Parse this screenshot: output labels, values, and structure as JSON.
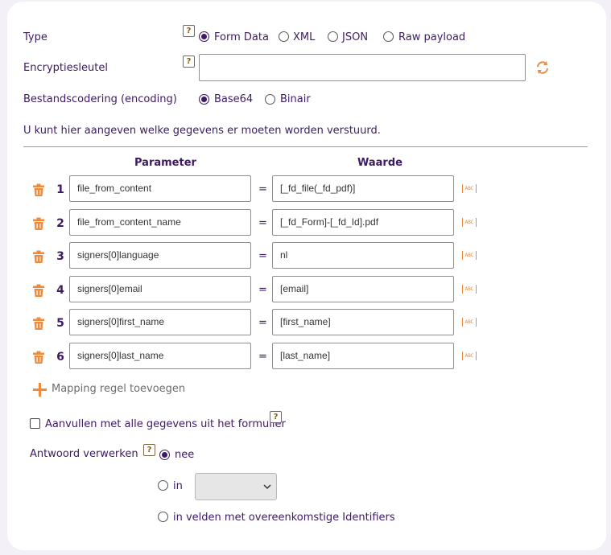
{
  "type_row": {
    "label": "Type",
    "options": [
      "Form Data",
      "XML",
      "JSON",
      "Raw payload"
    ],
    "selected": "Form Data"
  },
  "encryption": {
    "label": "Encryptiesleutel",
    "value": ""
  },
  "encoding": {
    "label": "Bestandscodering (encoding)",
    "options": [
      "Base64",
      "Binair"
    ],
    "selected": "Base64"
  },
  "help_glyph": "?",
  "info_text": "U kunt hier aangeven welke gegevens er moeten worden verstuurd.",
  "columns": {
    "parameter": "Parameter",
    "value": "Waarde"
  },
  "equals": "=",
  "abc_glyph": "ABC",
  "mapping": [
    {
      "num": "1",
      "param": "file_from_content",
      "value": "[_fd_file(_fd_pdf)]"
    },
    {
      "num": "2",
      "param": "file_from_content_name",
      "value": "[_fd_Form]-[_fd_Id].pdf"
    },
    {
      "num": "3",
      "param": "signers[0]language",
      "value": "nl"
    },
    {
      "num": "4",
      "param": "signers[0]email",
      "value": "[email]"
    },
    {
      "num": "5",
      "param": "signers[0]first_name",
      "value": "[first_name]"
    },
    {
      "num": "6",
      "param": "signers[0]last_name",
      "value": "[last_name]"
    }
  ],
  "add_rule_label": "Mapping regel toevoegen",
  "fill_all": {
    "label": "Aanvullen met alle gegevens uit het formulier",
    "checked": false
  },
  "response": {
    "label": "Antwoord verwerken",
    "options": [
      "nee",
      "in",
      "in velden met overeenkomstige Identifiers"
    ],
    "selected": "nee",
    "select_value": ""
  },
  "colors": {
    "accent": "#3d1a63",
    "icon": "#f08a3c"
  }
}
